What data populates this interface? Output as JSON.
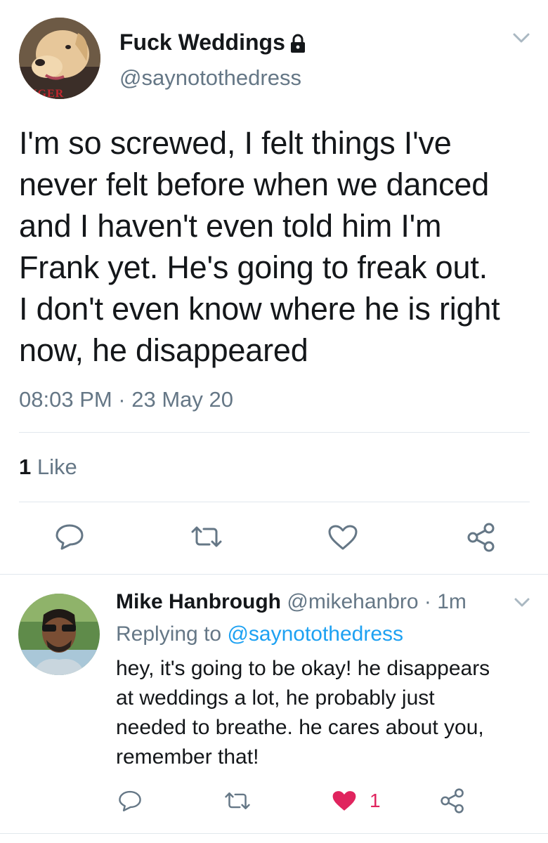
{
  "main_tweet": {
    "display_name": "Fuck Weddings",
    "handle": "@saynotothedress",
    "avatar_caption": "NGER",
    "lines": [
      "I'm so screwed, I felt things I've",
      "never felt before when we danced",
      "and I haven't even told him I'm",
      "Frank yet. He's going to freak out.",
      "I don't even know where he is right",
      "now, he disappeared"
    ],
    "timestamp": "08:03 PM · 23 May 20",
    "likes_count": "1",
    "likes_label": "Like"
  },
  "icons": {
    "lock": "lock-icon",
    "chevron": "chevron-down-icon",
    "reply": "reply-icon",
    "retweet": "retweet-icon",
    "like": "heart-icon",
    "share": "share-icon"
  },
  "reply_tweet": {
    "display_name": "Mike Hanbrough",
    "handle": "@mikehanbro",
    "time": "· 1m",
    "replying_prefix": "Replying to",
    "replying_to": "@saynotothedress",
    "lines": [
      "hey, it's going to be okay! he disappears",
      "at weddings a lot, he probably just",
      "needed to breathe. he cares about you,",
      "remember that!"
    ],
    "like_count": "1"
  },
  "colors": {
    "accent": "#1da1f2",
    "muted": "#657786",
    "liked": "#e0245e"
  }
}
